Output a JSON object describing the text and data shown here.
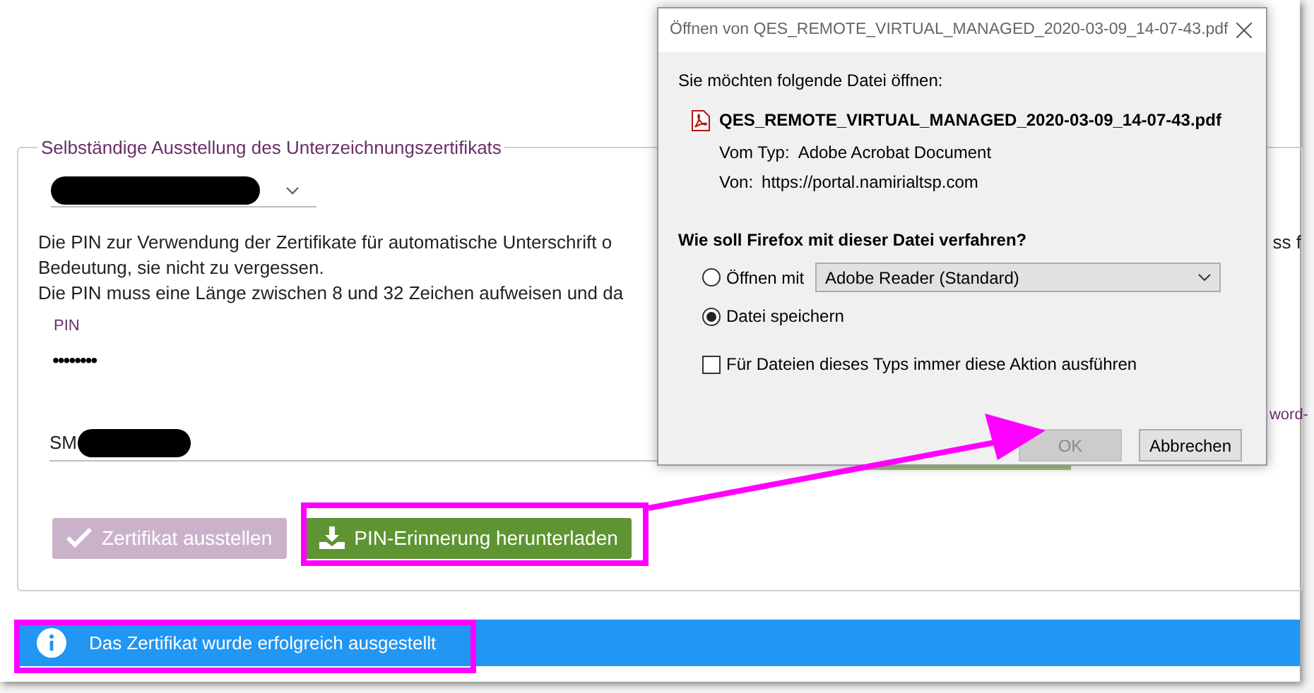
{
  "form": {
    "legend": "Selbständige Ausstellung des Unterzeichnungszertifikats",
    "intro_lines": [
      "Die PIN zur Verwendung der Zertifikate für automatische Unterschrift o",
      "Bedeutung, sie nicht zu vergessen.",
      "Die PIN muss eine Länge zwischen 8 und 32 Zeichen aufweisen und da"
    ],
    "intro_right": "ss f",
    "pin": {
      "label": "PIN",
      "value": "••••••••"
    },
    "name_field": {
      "value": "SM"
    },
    "side_link": "word-"
  },
  "buttons": [
    {
      "label": "Zertifikat ausstellen",
      "kind": "issue",
      "disabled": true
    },
    {
      "label": "PIN-Erinnerung herunterladen",
      "kind": "download",
      "disabled": false
    }
  ],
  "notification": {
    "text": "Das Zertifikat wurde erfolgreich ausgestellt"
  },
  "dialog": {
    "title": "Öffnen von QES_REMOTE_VIRTUAL_MANAGED_2020-03-09_14-07-43.pdf",
    "prompt": "Sie möchten folgende Datei öffnen:",
    "file_name": "QES_REMOTE_VIRTUAL_MANAGED_2020-03-09_14-07-43.pdf",
    "details": [
      {
        "label": "Vom Typ:",
        "value": "Adobe Acrobat Document"
      },
      {
        "label": "Von:",
        "value": "https://portal.namirialtsp.com"
      }
    ],
    "question": "Wie soll Firefox mit dieser Datei verfahren?",
    "options": [
      {
        "label": "Öffnen mit",
        "selected": false,
        "app": "Adobe Reader (Standard)"
      },
      {
        "label": "Datei speichern",
        "selected": true
      }
    ],
    "remember": {
      "label": "Für Dateien dieses Typs immer diese Aktion ausführen",
      "checked": false
    },
    "buttons": [
      {
        "label": "OK",
        "disabled": true
      },
      {
        "label": "Abbrechen",
        "disabled": false
      }
    ]
  }
}
